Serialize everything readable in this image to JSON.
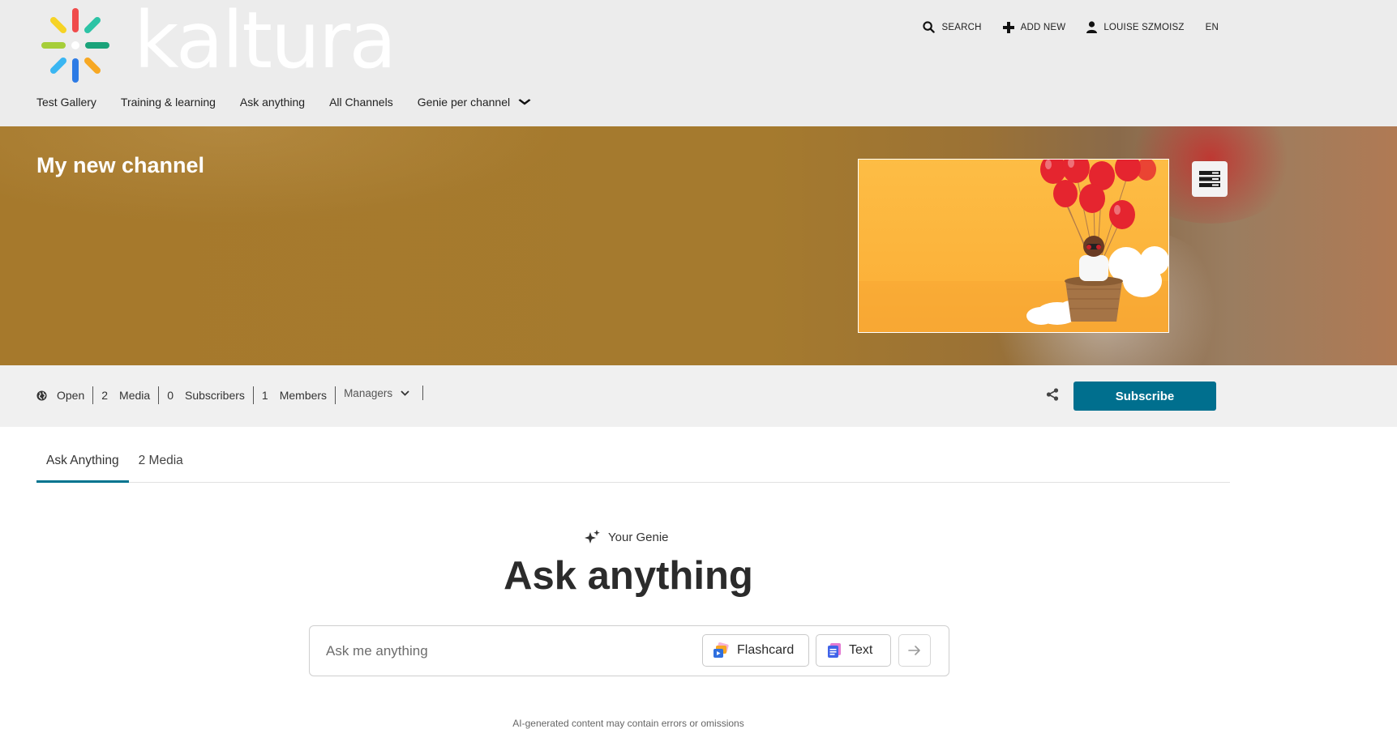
{
  "brand": {
    "name": "kaltura"
  },
  "topbar": {
    "search_label": "SEARCH",
    "add_new_label": "ADD NEW",
    "user_label": "LOUISE SZMOISZ",
    "language_label": "EN"
  },
  "nav": {
    "items": [
      {
        "label": "Test Gallery"
      },
      {
        "label": "Training & learning"
      },
      {
        "label": "Ask anything"
      },
      {
        "label": "All Channels"
      },
      {
        "label": "Genie per channel"
      }
    ]
  },
  "channel": {
    "title": "My new channel"
  },
  "stats": {
    "privacy": "Open",
    "media_count": "2",
    "media_label": "Media",
    "subscribers_count": "0",
    "subscribers_label": "Subscribers",
    "members_count": "1",
    "members_label": "Members",
    "managers_label": "Managers"
  },
  "actions": {
    "subscribe_label": "Subscribe"
  },
  "tabs": [
    {
      "label": "Ask Anything"
    },
    {
      "label": "2 Media"
    }
  ],
  "genie": {
    "label": "Your Genie",
    "title": "Ask anything",
    "placeholder": "Ask me anything",
    "flashcard_label": "Flashcard",
    "text_label": "Text",
    "disclaimer": "AI-generated content may contain errors or omissions"
  },
  "colors": {
    "accent": "#006f8e",
    "header_bg": "#ececec",
    "banner_bg": "#a6792c"
  }
}
